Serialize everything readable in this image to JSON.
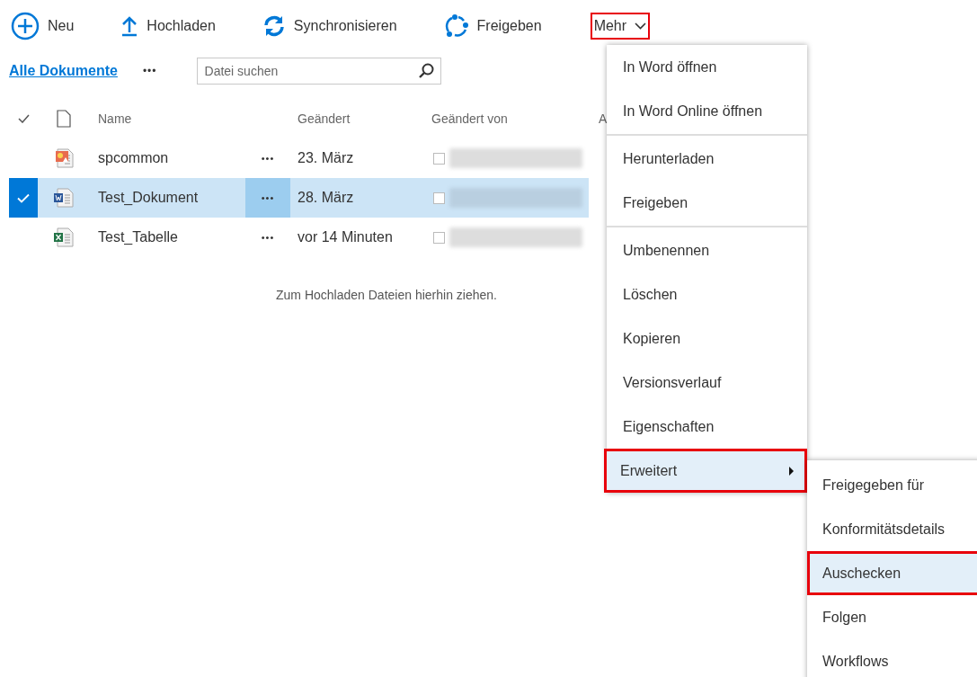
{
  "toolbar": [
    {
      "kind": "new",
      "label": "Neu",
      "outlined": false
    },
    {
      "kind": "upload",
      "label": "Hochladen",
      "outlined": false
    },
    {
      "kind": "sync",
      "label": "Synchronisieren",
      "outlined": false
    },
    {
      "kind": "share",
      "label": "Freigeben",
      "outlined": false
    },
    {
      "kind": "more",
      "label": "Mehr",
      "outlined": true
    }
  ],
  "view": {
    "title": "Alle Dokumente",
    "more": "•••",
    "search": {
      "placeholder": "Datei suchen"
    }
  },
  "table": {
    "columns": [
      "Name",
      "Geändert",
      "Geändert von",
      "A"
    ],
    "rows": [
      {
        "kind": "image",
        "name": "spcommon",
        "more": "•••",
        "modified": "23. März",
        "selected": false,
        "checked": false
      },
      {
        "kind": "word",
        "name": "Test_Dokument",
        "more": "•••",
        "modified": "28. März",
        "selected": true,
        "checked": false
      },
      {
        "kind": "excel",
        "name": "Test_Tabelle",
        "more": "•••",
        "modified": "vor 14 Minuten",
        "selected": false,
        "checked": false
      }
    ],
    "empty_hint": "Zum Hochladen Dateien hierhin ziehen."
  },
  "menu": {
    "groups": [
      [
        {
          "label": "In Word öffnen",
          "selected": false,
          "outlined": false,
          "submenu": false
        },
        {
          "label": "In Word Online öffnen",
          "selected": false,
          "outlined": false,
          "submenu": false
        }
      ],
      [
        {
          "label": "Herunterladen",
          "selected": false,
          "outlined": false,
          "submenu": false
        },
        {
          "label": "Freigeben",
          "selected": false,
          "outlined": false,
          "submenu": false
        }
      ],
      [
        {
          "label": "Umbenennen",
          "selected": false,
          "outlined": false,
          "submenu": false
        },
        {
          "label": "Löschen",
          "selected": false,
          "outlined": false,
          "submenu": false
        },
        {
          "label": "Kopieren",
          "selected": false,
          "outlined": false,
          "submenu": false
        },
        {
          "label": "Versionsverlauf",
          "selected": false,
          "outlined": false,
          "submenu": false
        },
        {
          "label": "Eigenschaften",
          "selected": false,
          "outlined": false,
          "submenu": false
        }
      ],
      [
        {
          "label": "Erweitert",
          "selected": true,
          "outlined": true,
          "submenu": true
        }
      ]
    ]
  },
  "submenu": {
    "items": [
      {
        "label": "Freigegeben für",
        "selected": false,
        "outlined": false
      },
      {
        "label": "Konformitätsdetails",
        "selected": false,
        "outlined": false
      },
      {
        "label": "Auschecken",
        "selected": true,
        "outlined": true
      },
      {
        "label": "Folgen",
        "selected": false,
        "outlined": false
      },
      {
        "label": "Workflows",
        "selected": false,
        "outlined": false
      }
    ]
  }
}
